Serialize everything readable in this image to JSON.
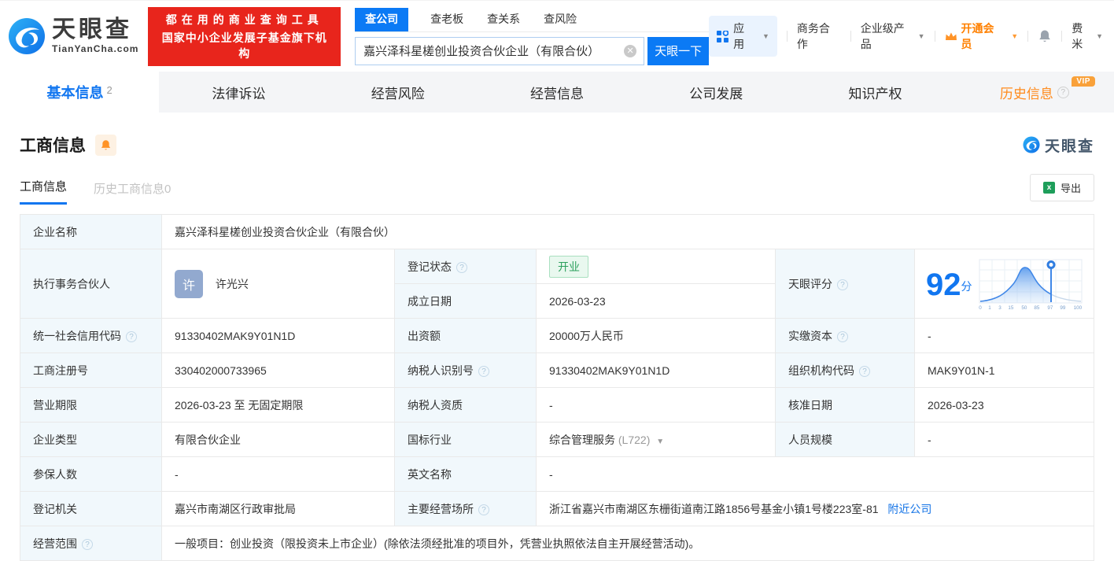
{
  "colors": {
    "accent_blue": "#1176f0",
    "banner_red": "#e8251c",
    "vip_orange": "#ff8b1d",
    "status_green": "#2ba05c",
    "label_bg": "#f1f8fc"
  },
  "header": {
    "logo_title": "天眼查",
    "logo_domain": "TianYanCha.com",
    "banner_line1": "都在用的商业查询工具",
    "banner_line2": "国家中小企业发展子基金旗下机构",
    "search_tabs": [
      "查公司",
      "查老板",
      "查关系",
      "查风险"
    ],
    "search_value": "嘉兴泽科星槎创业投资合伙企业（有限合伙）",
    "search_button": "天眼一下",
    "nav": {
      "apps": "应用",
      "cooperation": "商务合作",
      "enterprise": "企业级产品",
      "vip": "开通会员",
      "user": "费米"
    }
  },
  "tabs": {
    "basic": "基本信息",
    "basic_count": "2",
    "legal": "法律诉讼",
    "risk": "经营风险",
    "operating": "经营信息",
    "development": "公司发展",
    "ip": "知识产权",
    "history": "历史信息",
    "history_vip": "VIP"
  },
  "section": {
    "title": "工商信息",
    "watermark": "天眼查",
    "subtab_active": "工商信息",
    "subtab_history": "历史工商信息0",
    "export_label": "导出"
  },
  "score": {
    "label": "天眼评分",
    "value": "92",
    "unit": "分",
    "axis": [
      "0",
      "1",
      "3",
      "15",
      "50",
      "85",
      "97",
      "99",
      "100"
    ]
  },
  "fields": {
    "company_name": {
      "label": "企业名称",
      "value": "嘉兴泽科星槎创业投资合伙企业（有限合伙）"
    },
    "partner": {
      "label": "执行事务合伙人",
      "avatar": "许",
      "name": "许光兴"
    },
    "reg_status": {
      "label": "登记状态",
      "value": "开业"
    },
    "establish_date": {
      "label": "成立日期",
      "value": "2026-03-23"
    },
    "credit_code": {
      "label": "统一社会信用代码",
      "value": "91330402MAK9Y01N1D"
    },
    "capital": {
      "label": "出资额",
      "value": "20000万人民币"
    },
    "paid_capital": {
      "label": "实缴资本",
      "value": "-"
    },
    "reg_number": {
      "label": "工商注册号",
      "value": "330402000733965"
    },
    "taxpayer_id": {
      "label": "纳税人识别号",
      "value": "91330402MAK9Y01N1D"
    },
    "org_code": {
      "label": "组织机构代码",
      "value": "MAK9Y01N-1"
    },
    "business_term": {
      "label": "营业期限",
      "value": "2026-03-23 至 无固定期限"
    },
    "taxpayer_qualification": {
      "label": "纳税人资质",
      "value": "-"
    },
    "approval_date": {
      "label": "核准日期",
      "value": "2026-03-23"
    },
    "company_type": {
      "label": "企业类型",
      "value": "有限合伙企业"
    },
    "industry": {
      "label": "国标行业",
      "value": "综合管理服务",
      "code": "(L722)"
    },
    "staff_size": {
      "label": "人员规模",
      "value": "-"
    },
    "insured_count": {
      "label": "参保人数",
      "value": "-"
    },
    "english_name": {
      "label": "英文名称",
      "value": "-"
    },
    "reg_authority": {
      "label": "登记机关",
      "value": "嘉兴市南湖区行政审批局"
    },
    "business_address": {
      "label": "主要经营场所",
      "value": "浙江省嘉兴市南湖区东栅街道南江路1856号基金小镇1号楼223室-81",
      "link": "附近公司"
    },
    "business_scope": {
      "label": "经营范围",
      "value": "一般项目：创业投资（限投资未上市企业）(除依法须经批准的项目外，凭营业执照依法自主开展经营活动)。"
    }
  }
}
